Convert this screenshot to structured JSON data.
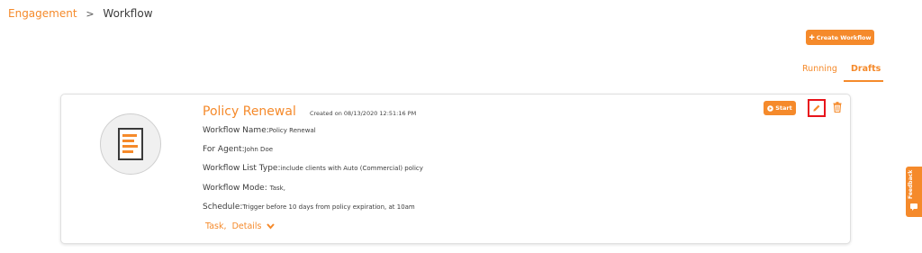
{
  "breadcrumb": {
    "parent": "Engagement",
    "separator": ">",
    "current": "Workflow"
  },
  "toolbar": {
    "create_label": "Create Workflow",
    "create_icon": "plus-icon"
  },
  "tabs": [
    {
      "label": "Running",
      "active": false
    },
    {
      "label": "Drafts",
      "active": true
    }
  ],
  "workflow": {
    "title": "Policy Renewal",
    "created": "Created on 08/13/2020 12:51:16 PM",
    "fields": [
      {
        "label": "Workflow Name:",
        "value": "Policy Renewal"
      },
      {
        "label": "For Agent:",
        "value": "John Doe"
      },
      {
        "label": "Workflow List Type:",
        "value": "include clients with Auto (Commercial) policy"
      },
      {
        "label": "Workflow Mode: ",
        "value": "Task,"
      },
      {
        "label": "Schedule:",
        "value": "Trigger before 10 days from policy expiration, at 10am"
      }
    ],
    "task_label": "Task,",
    "details_label": "Details",
    "start_label": "Start",
    "icons": {
      "avatar": "document-icon",
      "start": "play-circle-icon",
      "edit": "pencil-icon",
      "delete": "trash-icon",
      "details": "chevron-down-icon"
    }
  },
  "feedback": {
    "label": "Feedback",
    "icon": "chat-icon"
  },
  "colors": {
    "accent": "#f58a2b",
    "highlight_border": "#e8141b",
    "text": "#3c3c3c"
  }
}
